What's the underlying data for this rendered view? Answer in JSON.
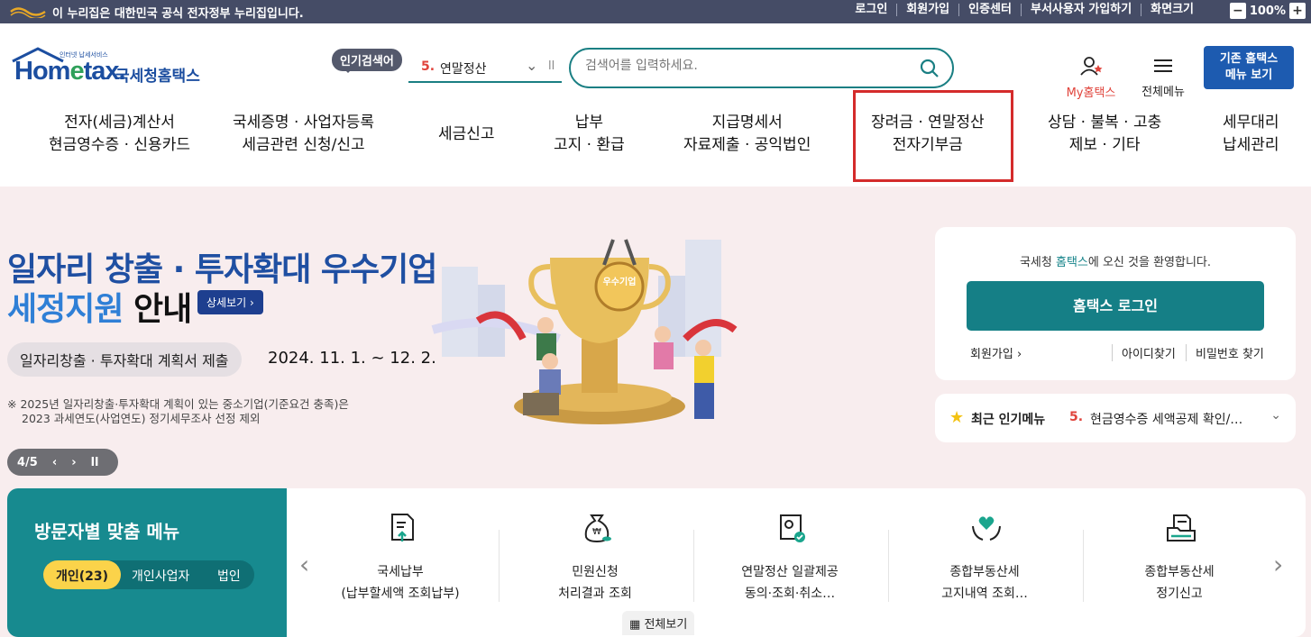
{
  "gov_bar": {
    "notice": "이 누리집은 대한민국 공식 전자정부 누리집입니다.",
    "links": [
      "로그인",
      "회원가입",
      "인증센터",
      "부서사용자 가입하기",
      "화면크기"
    ],
    "zoom_minus": "−",
    "zoom_value": "100%",
    "zoom_plus": "+"
  },
  "header": {
    "logo_text_a": "Hom",
    "logo_text_e": "e",
    "logo_text_b": "tax.",
    "logo_sub": "인터넷 납세서비스",
    "logo_kr": "국세청홈택스",
    "popular_badge": "인기검색어",
    "popular_rank": "5.",
    "popular_keyword": "연말정산",
    "search_placeholder": "검색어를 입력하세요.",
    "my_hometax": "My홈택스",
    "all_menu": "전체메뉴",
    "old_menu_line1": "기존 홈택스",
    "old_menu_line2": "메뉴 보기"
  },
  "gnb": [
    {
      "line1": "전자(세금)계산서",
      "line2": "현금영수증 · 신용카드"
    },
    {
      "line1": "국세증명 · 사업자등록",
      "line2": "세금관련 신청/신고"
    },
    {
      "line1": "세금신고",
      "line2": ""
    },
    {
      "line1": "납부",
      "line2": "고지 · 환급"
    },
    {
      "line1": "지급명세서",
      "line2": "자료제출 · 공익법인"
    },
    {
      "line1": "장려금 · 연말정산",
      "line2": "전자기부금"
    },
    {
      "line1": "상담 · 불복 · 고충",
      "line2": "제보 · 기타"
    },
    {
      "line1": "세무대리",
      "line2": "납세관리"
    }
  ],
  "hero": {
    "title_line1": "일자리 창출 · 투자확대 우수기업",
    "title_line2_blue": "세정지원",
    "title_line2_dark": " 안내",
    "detail_btn": "상세보기",
    "pill": "일자리창출 · 투자확대 계획서 제출",
    "period": "2024. 11. 1. ~ 12. 2.",
    "note_line1": "※ 2025년 일자리창출·투자확대 계획이 있는 중소기업(기준요건 충족)은",
    "note_line2": "2023 과세연도(사업연도) 정기세무조사 선정 제외",
    "slide_counter": "4/5",
    "trophy_label": "우수기업"
  },
  "login": {
    "welcome_pre": "국세청 ",
    "welcome_hl": "홈택스",
    "welcome_post": "에 오신 것을 환영합니다.",
    "login_btn": "홈택스 로그인",
    "join": "회원가입",
    "find_id": "아이디찾기",
    "find_pw": "비밀번호 찾기"
  },
  "recent": {
    "label": "최근 인기메뉴",
    "rank": "5.",
    "text": "현금영수증 세액공제 확인/변경"
  },
  "visitor": {
    "title": "방문자별 맞춤 메뉴",
    "tabs": [
      "개인(23)",
      "개인사업자",
      "법인"
    ]
  },
  "quick": [
    {
      "icon": "document-upload-icon",
      "line1": "국세납부",
      "line2": "(납부할세액 조회납부)"
    },
    {
      "icon": "money-bag-icon",
      "line1": "민원신청",
      "line2": "처리결과 조회"
    },
    {
      "icon": "certificate-icon",
      "line1": "연말정산 일괄제공",
      "line2": "동의·조회·취소…"
    },
    {
      "icon": "hands-heart-icon",
      "line1": "종합부동산세",
      "line2": "고지내역 조회…"
    },
    {
      "icon": "folder-document-icon",
      "line1": "종합부동산세",
      "line2": "정기신고"
    }
  ],
  "view_all": "전체보기",
  "colors": {
    "teal": "#157f86",
    "navy": "#1d5bb0",
    "highlight": "#d42b2b",
    "hero_bg": "#f8edee"
  }
}
